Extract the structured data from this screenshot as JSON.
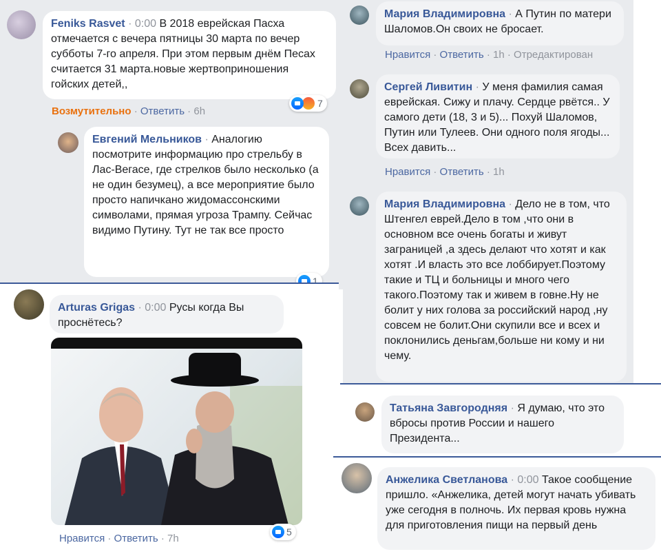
{
  "c1": {
    "author": "Feniks Rasvet",
    "time": "0:00",
    "text": "В 2018 еврейская Пасха отмечается с вечера пятницы 30 марта по вечер субботы 7-го апреля. При этом первым днём Песах считается 31 марта.новые жертвоприношения гойских детей,,",
    "reaction_label": "Возмутительно",
    "reply": "Ответить",
    "age": "6h",
    "reaction_count": "7"
  },
  "c2": {
    "author": "Евгений Мельников",
    "text": "Аналогию посмотрите информацию про стрельбу в Лас-Вегасе, где стрелков было несколько (а не один безумец), а все мероприятие было просто напичкано жидомассонскими символами, прямая угроза Трампу. Сейчас видимо Путину. Тут не так все просто",
    "reaction_count": "1"
  },
  "c3": {
    "author": "Arturas Grigas",
    "time": "0:00",
    "text": "Русы когда Вы проснётесь?",
    "like": "Нравится",
    "reply": "Ответить",
    "age": "7h",
    "reaction_count": "5"
  },
  "c4": {
    "author": "Мария Владимировна",
    "text": "А Путин по матери Шаломов.Он своих не бросает.",
    "like": "Нравится",
    "reply": "Ответить",
    "age": "1h",
    "edited": "Отредактирован"
  },
  "c5": {
    "author": "Сергей Ливитин",
    "text": "У меня фамилия самая еврейская. Сижу и плачу. Сердце рвётся.. У самого дети (18, 3 и 5)... Похуй Шаломов, Путин или Тулеев. Они одного поля ягоды... Всех давить...",
    "like": "Нравится",
    "reply": "Ответить",
    "age": "1h"
  },
  "c6": {
    "author": "Мария Владимировна",
    "text": "Дело не в том, что Штенгел еврей.Дело в том ,что они в основном все очень богаты и живут заграницей ,а здесь делают что хотят и как хотят .И власть это все лоббирует.Поэтому такие и ТЦ и больницы и много чего такого.Поэтому так и живем в говне.Ну не болит у них голова за российский народ ,ну совсем не болит.Они скупили все и всех и поклонились деньгам,больше ни кому и ни чему."
  },
  "c7": {
    "author": "Татьяна Завгородняя",
    "text": "Я думаю, что это вбросы против России и нашего Президента..."
  },
  "c8": {
    "author": "Анжелика Светланова",
    "time": "0:00",
    "text": "Такое сообщение пришло. «Анжелика, детей могут начать убивать уже сегодня в полночь. Их первая кровь нужна для приготовления пищи на первый день"
  },
  "colors": {
    "link_blue": "#385898",
    "action_blue": "#4b67a1",
    "grey_text": "#90949c",
    "bubble_bg": "#f2f3f5",
    "wow_orange": "#e9710f"
  }
}
